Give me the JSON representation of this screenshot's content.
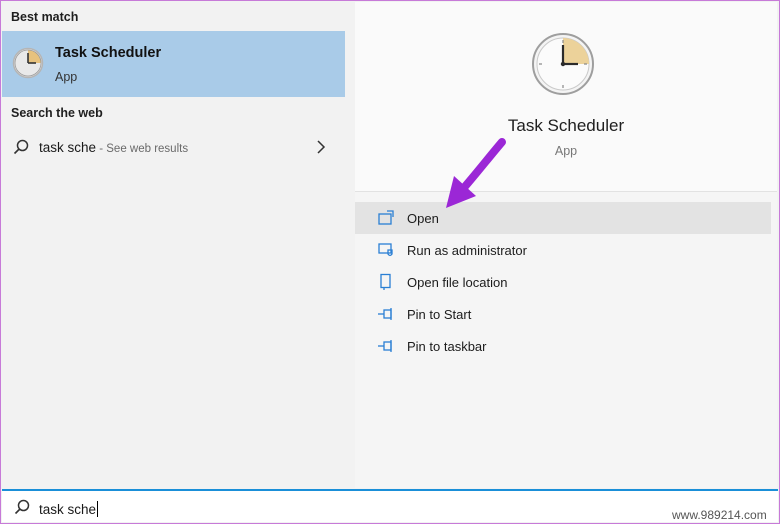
{
  "left": {
    "best_match_heading": "Best match",
    "best_item": {
      "title": "Task Scheduler",
      "subtitle": "App",
      "icon": "clock-icon"
    },
    "web_heading": "Search the web",
    "web_item": {
      "query": "task sche",
      "hint": " - See web results",
      "icon": "search-icon"
    }
  },
  "right": {
    "app_title": "Task Scheduler",
    "app_subtitle": "App",
    "actions": [
      {
        "label": "Open",
        "icon": "open-window-icon",
        "active": true
      },
      {
        "label": "Run as administrator",
        "icon": "shield-window-icon"
      },
      {
        "label": "Open file location",
        "icon": "file-location-icon"
      },
      {
        "label": "Pin to Start",
        "icon": "pin-icon"
      },
      {
        "label": "Pin to taskbar",
        "icon": "pin-icon"
      }
    ]
  },
  "searchbar": {
    "value": "task sche",
    "icon": "search-icon"
  },
  "watermark": "www.989214.com",
  "colors": {
    "selection": "#a9cbe8",
    "accent": "#1a8fd8",
    "icon_blue": "#2a7fd4",
    "arrow": "#9b27d6"
  }
}
